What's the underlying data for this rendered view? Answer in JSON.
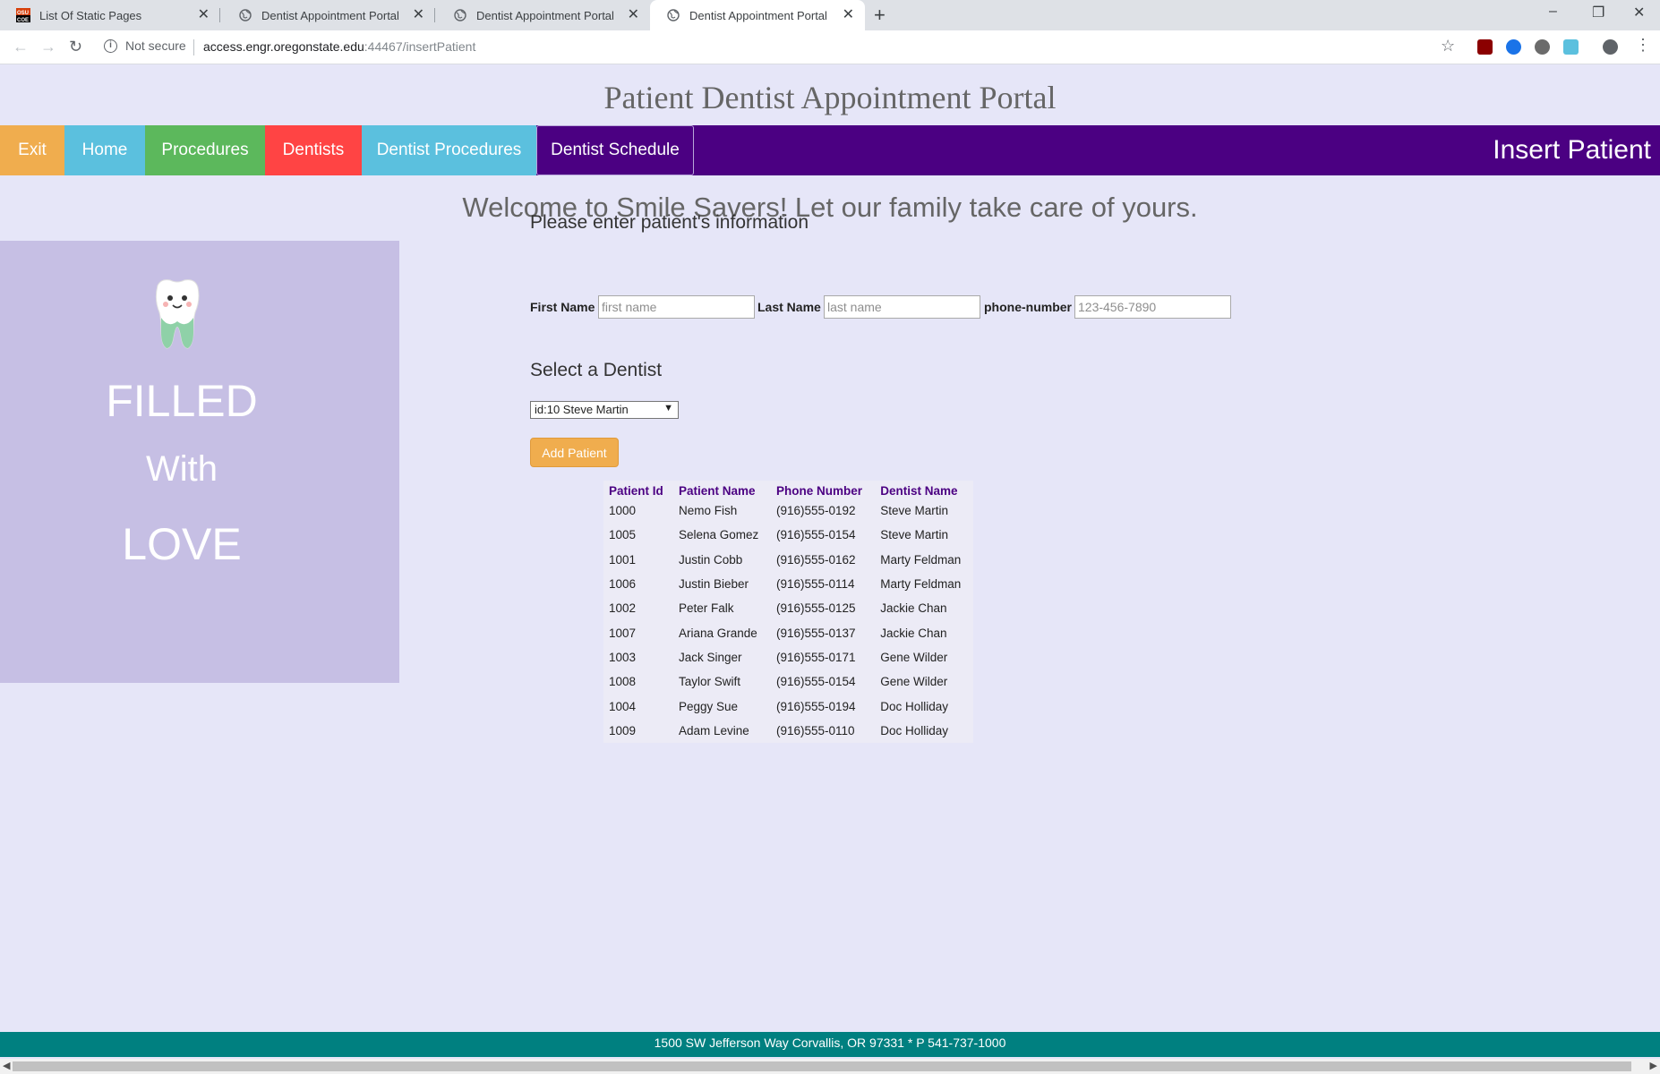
{
  "browser": {
    "tabs": [
      {
        "title": "List Of Static Pages",
        "icon": "osu-favicon-icon"
      },
      {
        "title": "Dentist Appointment Portal",
        "icon": "globe-icon"
      },
      {
        "title": "Dentist Appointment Portal",
        "icon": "globe-icon"
      },
      {
        "title": "Dentist Appointment Portal",
        "icon": "globe-icon",
        "active": true
      }
    ],
    "security_label": "Not secure",
    "url_host": "access.engr.oregonstate.edu",
    "url_path": ":44467/insertPatient"
  },
  "site": {
    "title": "Patient Dentist Appointment Portal",
    "nav": [
      {
        "label": "Exit",
        "color": "#f0ad4e"
      },
      {
        "label": "Home",
        "color": "#5bc0de"
      },
      {
        "label": "Procedures",
        "color": "#5cb85c"
      },
      {
        "label": "Dentists",
        "color": "#ff4444"
      },
      {
        "label": "Dentist Procedures",
        "color": "#5bc0de"
      },
      {
        "label": "Dentist Schedule",
        "color": "#4b0082"
      }
    ],
    "page_title": "Insert Patient",
    "welcome": "Welcome to Smile Savers! Let our family take care of yours."
  },
  "promo": {
    "line1": "FILLED",
    "line2": "With",
    "line3": "LOVE"
  },
  "form": {
    "heading": "Please enter patient's information",
    "first_name_label": "First Name",
    "first_name_placeholder": "first name",
    "last_name_label": "Last Name",
    "last_name_placeholder": "last name",
    "phone_label": "phone-number",
    "phone_placeholder": "123-456-7890",
    "dentist_heading": "Select a Dentist",
    "dentist_selected": "id:10 Steve Martin",
    "submit_label": "Add Patient"
  },
  "patients": {
    "headers": [
      "Patient Id",
      "Patient Name",
      "Phone Number",
      "Dentist Name"
    ],
    "rows": [
      [
        "1000",
        "Nemo Fish",
        "(916)555-0192",
        "Steve Martin"
      ],
      [
        "1005",
        "Selena Gomez",
        "(916)555-0154",
        "Steve Martin"
      ],
      [
        "1001",
        "Justin Cobb",
        "(916)555-0162",
        "Marty Feldman"
      ],
      [
        "1006",
        "Justin Bieber",
        "(916)555-0114",
        "Marty Feldman"
      ],
      [
        "1002",
        "Peter Falk",
        "(916)555-0125",
        "Jackie Chan"
      ],
      [
        "1007",
        "Ariana Grande",
        "(916)555-0137",
        "Jackie Chan"
      ],
      [
        "1003",
        "Jack Singer",
        "(916)555-0171",
        "Gene Wilder"
      ],
      [
        "1008",
        "Taylor Swift",
        "(916)555-0154",
        "Gene Wilder"
      ],
      [
        "1004",
        "Peggy Sue",
        "(916)555-0194",
        "Doc Holliday"
      ],
      [
        "1009",
        "Adam Levine",
        "(916)555-0110",
        "Doc Holliday"
      ]
    ]
  },
  "footer": {
    "text": "1500 SW Jefferson Way Corvallis, OR 97331 * P 541-737-1000"
  }
}
